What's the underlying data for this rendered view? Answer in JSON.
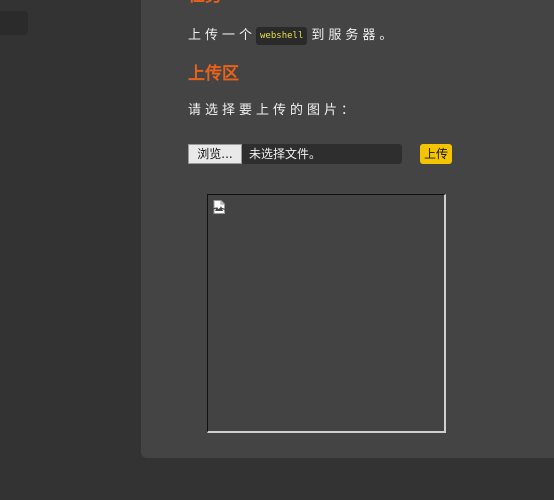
{
  "task": {
    "heading": "任务",
    "line_before": "上传一个",
    "code": "webshell",
    "line_after": "到服务器。"
  },
  "upload": {
    "heading": "上传区",
    "prompt": "请选择要上传的图片：",
    "browse_label": "浏览...",
    "file_status": "未选择文件。",
    "submit_label": "上传"
  },
  "preview": {
    "icon": "broken-image-icon"
  },
  "colors": {
    "heading": "#e8621c",
    "upload_button": "#f5c400",
    "code_text": "#e6e04a",
    "panel": "#444444",
    "background": "#333333"
  }
}
